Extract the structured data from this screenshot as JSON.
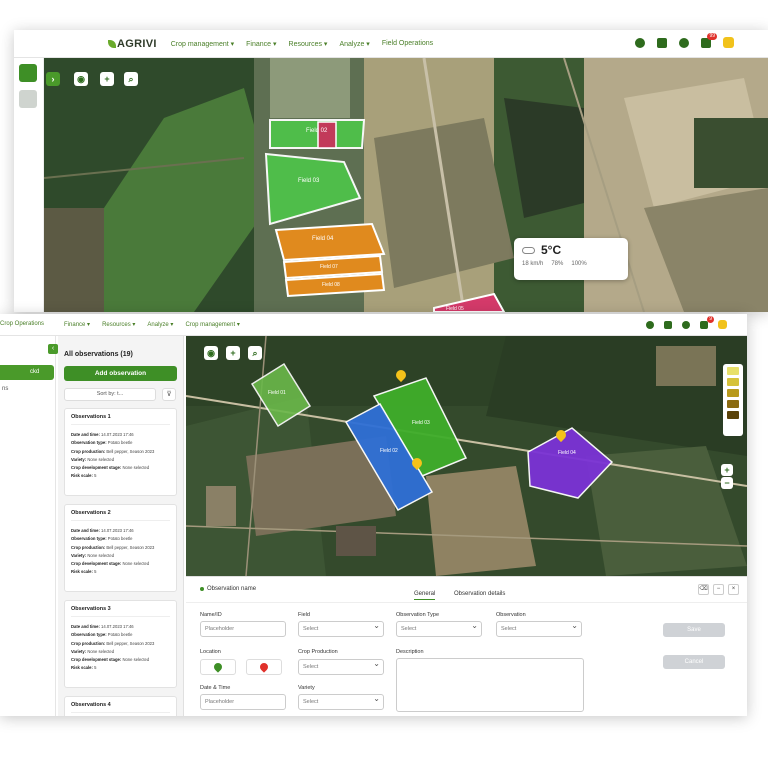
{
  "back": {
    "logo": "AGRIVI",
    "menu": [
      "Crop management ▾",
      "Finance ▾",
      "Resources ▾",
      "Analyze ▾",
      "Field Operations"
    ],
    "notification_count": "99",
    "field_labels": [
      "Field 02",
      "Field 03",
      "Field 04",
      "Field 07",
      "Field 08",
      "Field 05"
    ],
    "weather": {
      "temperature": "5°C",
      "wind": "18 km/h",
      "humidity": "78%",
      "rain": "100%"
    }
  },
  "front": {
    "menu": [
      "Crop Operations",
      "Finance ▾",
      "Resources ▾",
      "Analyze ▾",
      "Crop management ▾"
    ],
    "notification_count": "9",
    "nav": {
      "active": "ckd",
      "item2": "ns"
    },
    "observations": {
      "title": "All observations (19)",
      "add_button": "Add observation",
      "sort_label": "Sort by: t...",
      "filter_icon": "funnel-icon",
      "row_labels": [
        "Date and time:",
        "Observation type:",
        "Crop production:",
        "Variety:",
        "Crop development stage:",
        "Risk scale:"
      ],
      "cards": [
        {
          "title": "Observations 1",
          "values": [
            "14.07.2023 17:46",
            "Potato beetle",
            "Bell pepper, Season 2023",
            "None selected",
            "None selected",
            "5"
          ]
        },
        {
          "title": "Observations 2",
          "values": [
            "14.07.2023 17:46",
            "Potato beetle",
            "Bell pepper, Season 2023",
            "None selected",
            "None selected",
            "5"
          ]
        },
        {
          "title": "Observations 3",
          "values": [
            "14.07.2023 17:46",
            "Potato beetle",
            "Bell pepper, Season 2023",
            "None selected",
            "None selected",
            "5"
          ]
        },
        {
          "title": "Observations 4"
        }
      ]
    },
    "map_fields": [
      "Field 01",
      "Field 02",
      "Field 03",
      "Field 04"
    ],
    "form": {
      "observation_name": "Observation name",
      "tabs": [
        "General",
        "Observation details"
      ],
      "labels": {
        "name": "Name/ID",
        "field": "Field",
        "observation_type": "Observation Type",
        "observation": "Observation",
        "location": "Location",
        "crop_production": "Crop Production",
        "description": "Description",
        "date_time": "Date & Time",
        "variety": "Variety"
      },
      "placeholders": {
        "name": "Placeholder",
        "select": "Select",
        "date_time": "Placeholder"
      },
      "save": "Save",
      "cancel": "Cancel"
    },
    "legend_colors": [
      "#e8e06a",
      "#d6c23a",
      "#b89a1c",
      "#8a6a10",
      "#5a4208"
    ]
  }
}
